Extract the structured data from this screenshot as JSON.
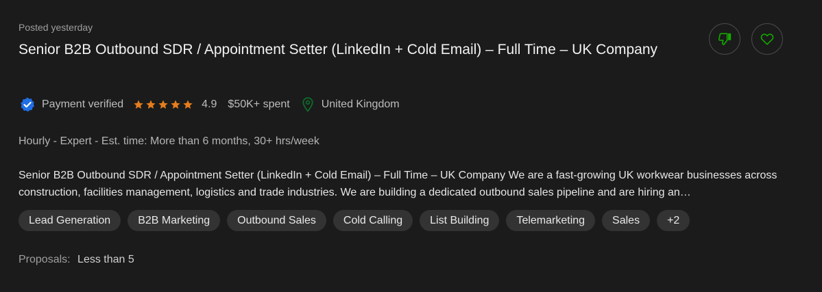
{
  "job": {
    "posted": "Posted yesterday",
    "title": "Senior B2B Outbound SDR / Appointment Setter (LinkedIn + Cold Email) – Full Time – UK Company",
    "payment_status": "Payment verified",
    "rating_value": "4.9",
    "rating_stars": 5,
    "spent": "$50K+ spent",
    "location": "United Kingdom",
    "terms": "Hourly - Expert - Est. time: More than 6 months, 30+ hrs/week",
    "description": "Senior B2B Outbound SDR / Appointment Setter (LinkedIn + Cold Email) – Full Time – UK Company We are a fast-growing UK workwear businesses across construction, facilities management, logistics and trade industries. We are building a dedicated outbound sales pipeline and are hiring an…",
    "skills": [
      "Lead Generation",
      "B2B Marketing",
      "Outbound Sales",
      "Cold Calling",
      "List Building",
      "Telemarketing",
      "Sales",
      "+2"
    ],
    "proposals_label": "Proposals:",
    "proposals_value": "Less than 5"
  },
  "icons": {
    "dislike": "thumbs-down-icon",
    "save": "heart-icon",
    "verified": "verified-badge-icon",
    "star": "star-icon",
    "location": "location-pin-icon"
  },
  "colors": {
    "accent_green": "#14a800",
    "star_orange": "#e57d1c",
    "verified_blue": "#1f6fe5"
  }
}
